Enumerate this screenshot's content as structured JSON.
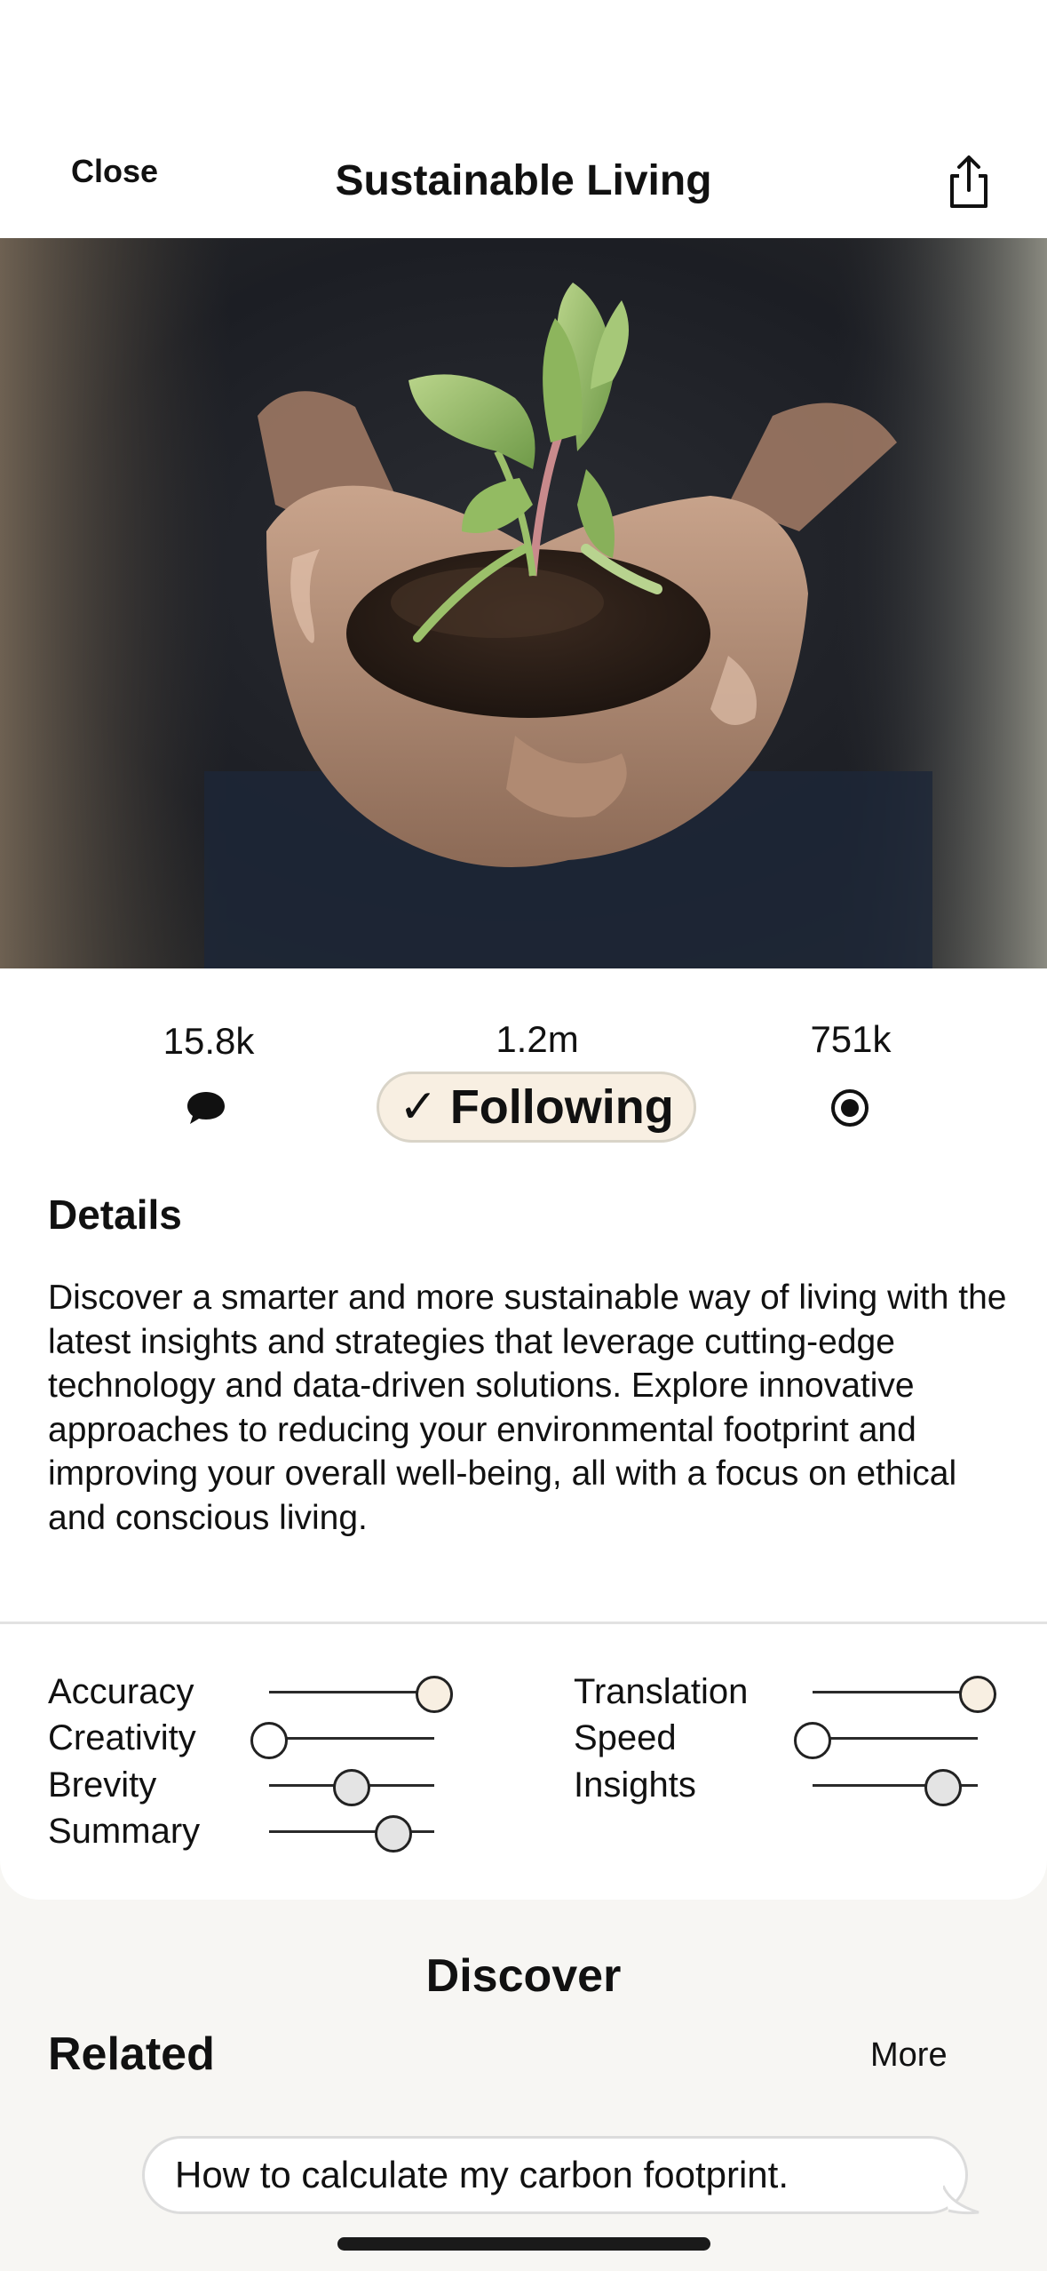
{
  "header": {
    "close_label": "Close",
    "title": "Sustainable Living",
    "share_icon": "share-icon"
  },
  "hero": {
    "subject": "hands holding soil with a seedling"
  },
  "stats": {
    "comments_count": "15.8k",
    "comments_icon": "speech-bubble-icon",
    "followers_count": "1.2m",
    "following_check": "✓",
    "following_label": "Following",
    "views_count": "751k",
    "views_icon": "radio-target-icon"
  },
  "details": {
    "heading": "Details",
    "body": "Discover a smarter and more sustainable way of living with the latest insights and strategies that leverage cutting-edge technology and data-driven solutions. Explore innovative approaches to reducing your environmental footprint and improving your overall well-being, all with a focus on ethical and conscious living."
  },
  "sliders": {
    "left": [
      {
        "label": "Accuracy",
        "value": 1.0
      },
      {
        "label": "Creativity",
        "value": 0.0
      },
      {
        "label": "Brevity",
        "value": 0.5
      },
      {
        "label": "Summary",
        "value": 0.75
      }
    ],
    "right": [
      {
        "label": "Translation",
        "value": 1.0
      },
      {
        "label": "Speed",
        "value": 0.0
      },
      {
        "label": "Insights",
        "value": 0.79
      }
    ],
    "colors": {
      "max_knob": "#f8efe2",
      "mid_knob": "#e4e4e4",
      "min_knob": "#ffffff"
    }
  },
  "discover": {
    "heading": "Discover",
    "related_heading": "Related",
    "more_label": "More",
    "suggestion": "How to calculate my carbon footprint."
  },
  "colors": {
    "accent_fill": "#f8efe2",
    "page_background": "#f7f6f3"
  }
}
